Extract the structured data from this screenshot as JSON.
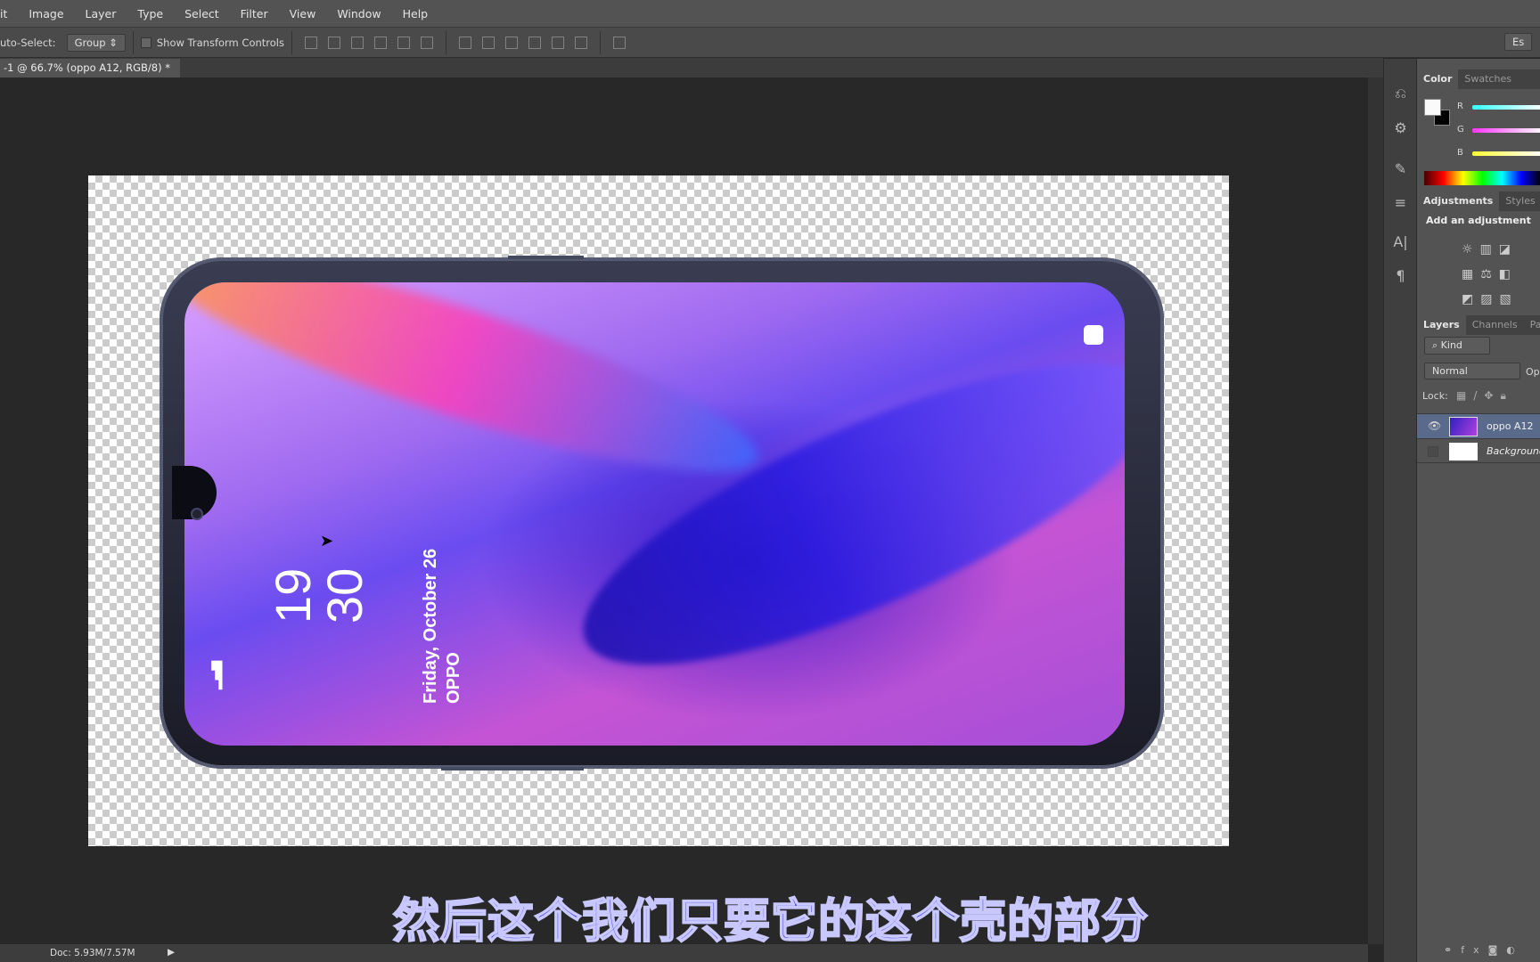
{
  "menu": [
    "it",
    "Image",
    "Layer",
    "Type",
    "Select",
    "Filter",
    "View",
    "Window",
    "Help"
  ],
  "options": {
    "auto_select_label": "uto-Select:",
    "auto_select_value": "Group",
    "show_transform": "Show Transform Controls",
    "esc_label": "Es"
  },
  "document_tab": {
    "title": "-1 @ 66.7% (oppo A12, RGB/8) *",
    "close": "×"
  },
  "phone_screen": {
    "hour": "19",
    "minute": "30",
    "date": "Friday, October 26",
    "brand": "OPPO"
  },
  "panels": {
    "color_tabs": [
      "Color",
      "Swatches"
    ],
    "channels": [
      "R",
      "G",
      "B"
    ],
    "adjust_tabs": [
      "Adjustments",
      "Styles"
    ],
    "add_adjustment": "Add an adjustment",
    "layers_tabs": [
      "Layers",
      "Channels",
      "Path"
    ],
    "kind": "Kind",
    "blend": "Normal",
    "opacity_label": "Op",
    "lock_label": "Lock:",
    "layers": [
      {
        "name": "oppo A12",
        "visible": true,
        "selected": true
      },
      {
        "name": "Background",
        "visible": false,
        "selected": false
      }
    ]
  },
  "status": {
    "doc": "Doc: 5.93M/7.57M"
  },
  "subtitle": "然后这个我们只要它的这个壳的部分",
  "colors": {
    "subtitle_fill": "#2b1fd8",
    "selected_layer": "#5a6a8a"
  }
}
